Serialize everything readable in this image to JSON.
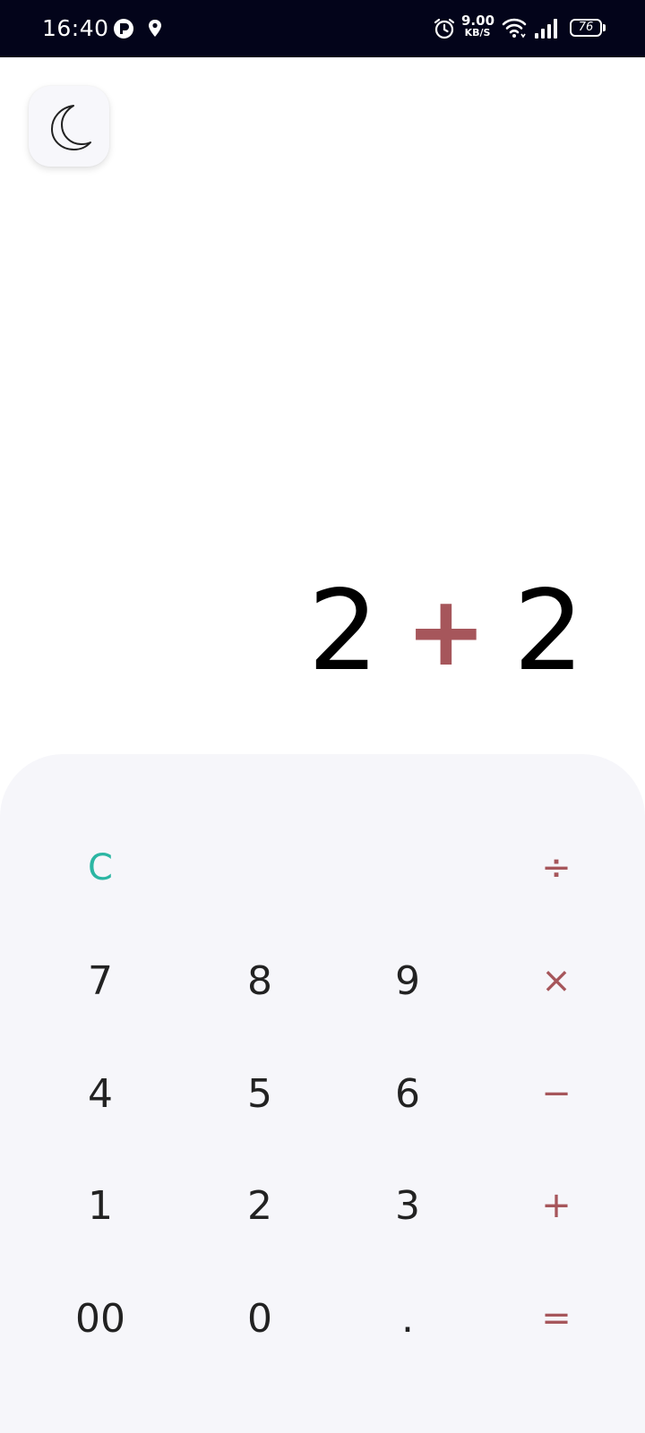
{
  "status_bar": {
    "time": "16:40",
    "network_speed_value": "9.00",
    "network_speed_unit": "KB/S",
    "battery": "76",
    "icons": [
      "app-notification-icon",
      "location-icon",
      "alarm-icon",
      "wifi-icon",
      "signal-icon",
      "battery-icon"
    ]
  },
  "theme_toggle": {
    "icon": "moon-icon"
  },
  "display": {
    "left_operand": "2",
    "operator": "+",
    "right_operand": "2"
  },
  "keypad": {
    "clear": "C",
    "divide": "÷",
    "multiply": "×",
    "subtract": "−",
    "add": "+",
    "equals": "=",
    "seven": "7",
    "eight": "8",
    "nine": "9",
    "four": "4",
    "five": "5",
    "six": "6",
    "one": "1",
    "two": "2",
    "three": "3",
    "double_zero": "00",
    "zero": "0",
    "decimal": "."
  },
  "colors": {
    "status_bar_bg": "#03041a",
    "operator": "#a6565b",
    "clear": "#2bb6a3",
    "keypad_bg": "#f6f6fa",
    "digit": "#222222"
  }
}
